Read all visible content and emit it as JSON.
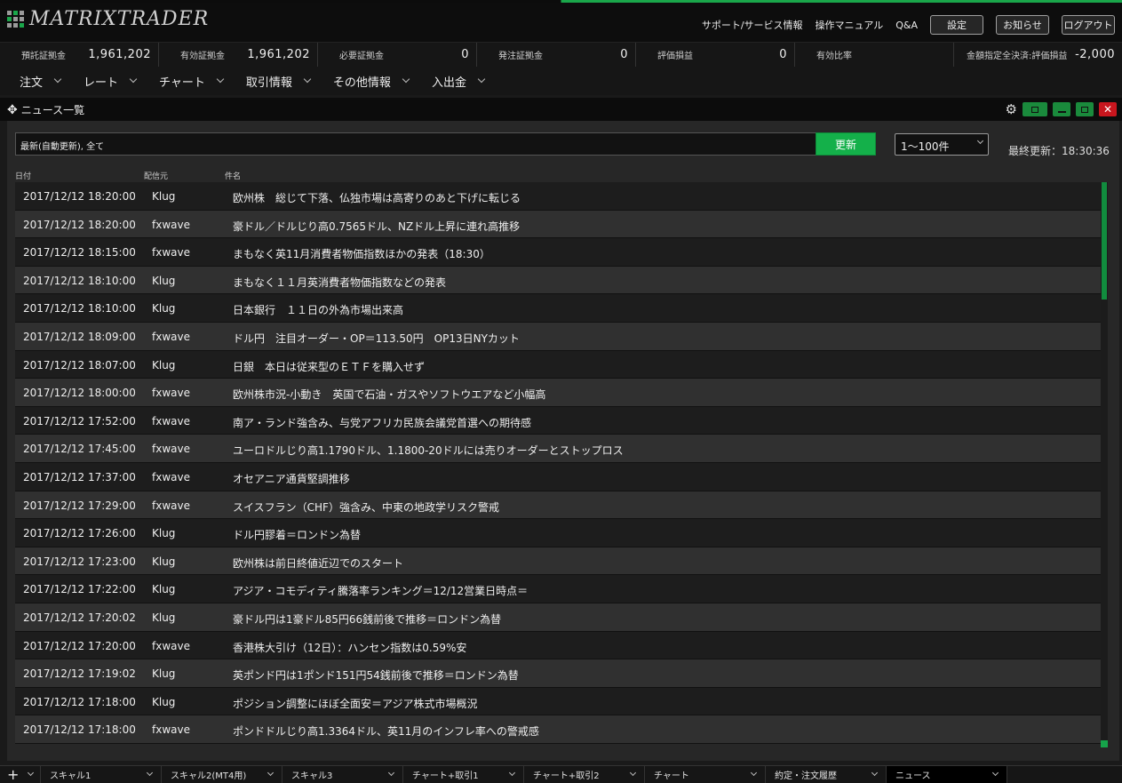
{
  "app": {
    "logo_text": "MATRIXTRADER"
  },
  "header": {
    "support": "サポート/サービス情報",
    "manual": "操作マニュアル",
    "qa": "Q&A",
    "settings": "設定",
    "notice": "お知らせ",
    "logout": "ログアウト"
  },
  "balance": [
    {
      "label": "預託証拠金",
      "value": "1,961,202"
    },
    {
      "label": "有効証拠金",
      "value": "1,961,202"
    },
    {
      "label": "必要証拠金",
      "value": "0"
    },
    {
      "label": "発注証拠金",
      "value": "0"
    },
    {
      "label": "評価損益",
      "value": "0"
    },
    {
      "label": "有効比率",
      "value": ""
    },
    {
      "label": "金額指定全決済:評価損益",
      "value": "-2,000"
    }
  ],
  "menu": [
    "注文",
    "レート",
    "チャート",
    "取引情報",
    "その他情報",
    "入出金"
  ],
  "panel": {
    "title": "ニュース一覧"
  },
  "filter": {
    "value": "最新(自動更新), 全て",
    "refresh": "更新",
    "range": "1〜100件",
    "last_update": "最終更新：18:30:36"
  },
  "columns": {
    "date": "日付",
    "source": "配信元",
    "title": "件名"
  },
  "news": [
    {
      "date": "2017/12/12 18:20:00",
      "source": "Klug",
      "title": "欧州株　総じて下落、仏独市場は高寄りのあと下げに転じる"
    },
    {
      "date": "2017/12/12 18:20:00",
      "source": "fxwave",
      "title": "豪ドル／ドルじり高0.7565ドル、NZドル上昇に連れ高推移"
    },
    {
      "date": "2017/12/12 18:15:00",
      "source": "fxwave",
      "title": "まもなく英11月消費者物価指数ほかの発表（18:30）"
    },
    {
      "date": "2017/12/12 18:10:00",
      "source": "Klug",
      "title": "まもなく１１月英消費者物価指数などの発表"
    },
    {
      "date": "2017/12/12 18:10:00",
      "source": "Klug",
      "title": "日本銀行　１１日の外為市場出来高"
    },
    {
      "date": "2017/12/12 18:09:00",
      "source": "fxwave",
      "title": "ドル円　注目オーダー・OP＝113.50円　OP13日NYカット"
    },
    {
      "date": "2017/12/12 18:07:00",
      "source": "Klug",
      "title": "日銀　本日は従来型のＥＴＦを購入せず"
    },
    {
      "date": "2017/12/12 18:00:00",
      "source": "fxwave",
      "title": "欧州株市況-小動き　英国で石油・ガスやソフトウエアなど小幅高"
    },
    {
      "date": "2017/12/12 17:52:00",
      "source": "fxwave",
      "title": "南ア・ランド強含み、与党アフリカ民族会議党首選への期待感"
    },
    {
      "date": "2017/12/12 17:45:00",
      "source": "fxwave",
      "title": "ユーロドルじり高1.1790ドル、1.1800-20ドルには売りオーダーとストップロス"
    },
    {
      "date": "2017/12/12 17:37:00",
      "source": "fxwave",
      "title": "オセアニア通貨堅調推移"
    },
    {
      "date": "2017/12/12 17:29:00",
      "source": "fxwave",
      "title": "スイスフラン（CHF）強含み、中東の地政学リスク警戒"
    },
    {
      "date": "2017/12/12 17:26:00",
      "source": "Klug",
      "title": "ドル円膠着＝ロンドン為替"
    },
    {
      "date": "2017/12/12 17:23:00",
      "source": "Klug",
      "title": "欧州株は前日終値近辺でのスタート"
    },
    {
      "date": "2017/12/12 17:22:00",
      "source": "Klug",
      "title": "アジア・コモディティ騰落率ランキング＝12/12営業日時点＝"
    },
    {
      "date": "2017/12/12 17:20:02",
      "source": "Klug",
      "title": "豪ドル円は1豪ドル85円66銭前後で推移＝ロンドン為替"
    },
    {
      "date": "2017/12/12 17:20:00",
      "source": "fxwave",
      "title": "香港株大引け（12日）：ハンセン指数は0.59%安"
    },
    {
      "date": "2017/12/12 17:19:02",
      "source": "Klug",
      "title": "英ポンド円は1ポンド151円54銭前後で推移＝ロンドン為替"
    },
    {
      "date": "2017/12/12 17:18:00",
      "source": "Klug",
      "title": "ポジション調整にほぼ全面安＝アジア株式市場概況"
    },
    {
      "date": "2017/12/12 17:18:00",
      "source": "fxwave",
      "title": "ポンドドルじり高1.3364ドル、英11月のインフレ率への警戒感"
    }
  ],
  "tabs": [
    "スキャル1",
    "スキャル2(MT4用)",
    "スキャル3",
    "チャート+取引1",
    "チャート+取引2",
    "チャート",
    "約定・注文履歴",
    "ニュース"
  ],
  "colors": {
    "accent": "#14b04a",
    "close": "#c8161e",
    "background": "#272727"
  }
}
